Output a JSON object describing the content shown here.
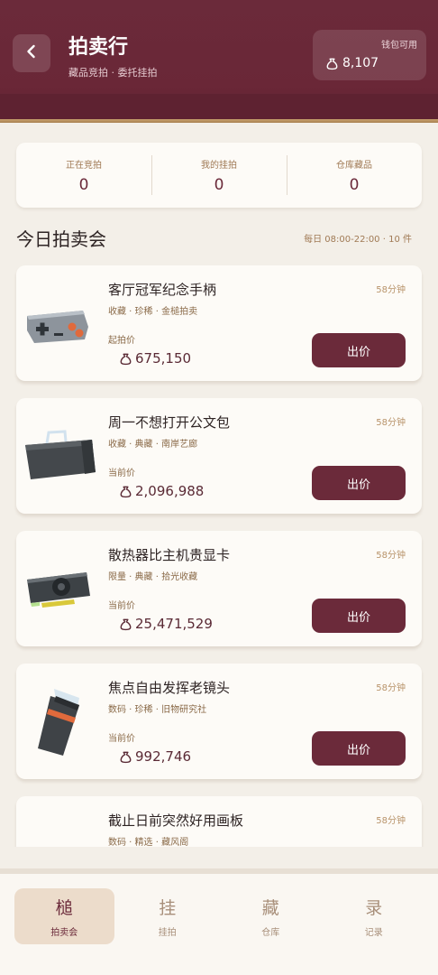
{
  "header": {
    "title": "拍卖行",
    "subtitle": "藏品竞拍 · 委托挂拍",
    "wallet_label": "钱包可用",
    "wallet_amount": "8,107"
  },
  "stats": [
    {
      "label": "正在竞拍",
      "value": "0"
    },
    {
      "label": "我的挂拍",
      "value": "0"
    },
    {
      "label": "仓库藏品",
      "value": "0"
    }
  ],
  "section": {
    "title": "今日拍卖会",
    "meta": "每日 08:00-22:00 · 10 件"
  },
  "items": [
    {
      "name": "客厅冠军纪念手柄",
      "tags": "收藏 · 珍稀 · 金槌拍卖",
      "time": "58分钟",
      "price_label": "起拍价",
      "price": "675,150",
      "bid_label": "出价",
      "icon": "gamepad-icon"
    },
    {
      "name": "周一不想打开公文包",
      "tags": "收藏 · 典藏 · 南岸艺廊",
      "time": "58分钟",
      "price_label": "当前价",
      "price": "2,096,988",
      "bid_label": "出价",
      "icon": "briefcase-icon"
    },
    {
      "name": "散热器比主机贵显卡",
      "tags": "限量 · 典藏 · 拾光收藏",
      "time": "58分钟",
      "price_label": "当前价",
      "price": "25,471,529",
      "bid_label": "出价",
      "icon": "graphics-card-icon"
    },
    {
      "name": "焦点自由发挥老镜头",
      "tags": "数码 · 珍稀 · 旧物研究社",
      "time": "58分钟",
      "price_label": "当前价",
      "price": "992,746",
      "bid_label": "出价",
      "icon": "camera-lens-icon"
    },
    {
      "name": "截止日前突然好用画板",
      "tags": "数码 · 精选 · 藏风阁",
      "time": "58分钟",
      "price_label": "",
      "price": "",
      "bid_label": "",
      "icon": "drawing-tablet-icon"
    }
  ],
  "nav": [
    {
      "glyph": "槌",
      "label": "拍卖会",
      "active": true
    },
    {
      "glyph": "挂",
      "label": "挂拍",
      "active": false
    },
    {
      "glyph": "藏",
      "label": "仓库",
      "active": false
    },
    {
      "glyph": "录",
      "label": "记录",
      "active": false
    }
  ],
  "colors": {
    "brand": "#6b2a3a",
    "accent_gold": "#c8a26f",
    "background": "#f3efe8"
  }
}
